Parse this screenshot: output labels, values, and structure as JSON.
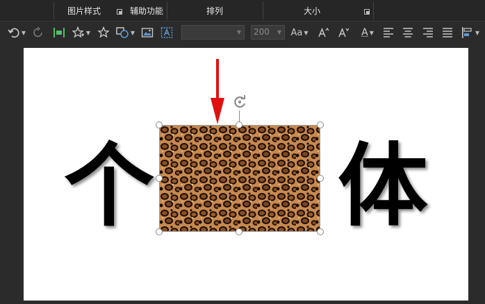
{
  "ribbon": {
    "groups": {
      "picture_styles": "图片样式",
      "accessibility": "辅助功能",
      "arrange": "排列",
      "size": "大小"
    }
  },
  "toolbar": {
    "font_size_value": "200",
    "change_case_label": "Aa",
    "font_color_label": "A"
  },
  "slide": {
    "chars": [
      "个",
      "体"
    ]
  },
  "colors": {
    "arrow": "#e01010",
    "ribbon_bg": "#262626",
    "slide_bg": "#ffffff"
  }
}
